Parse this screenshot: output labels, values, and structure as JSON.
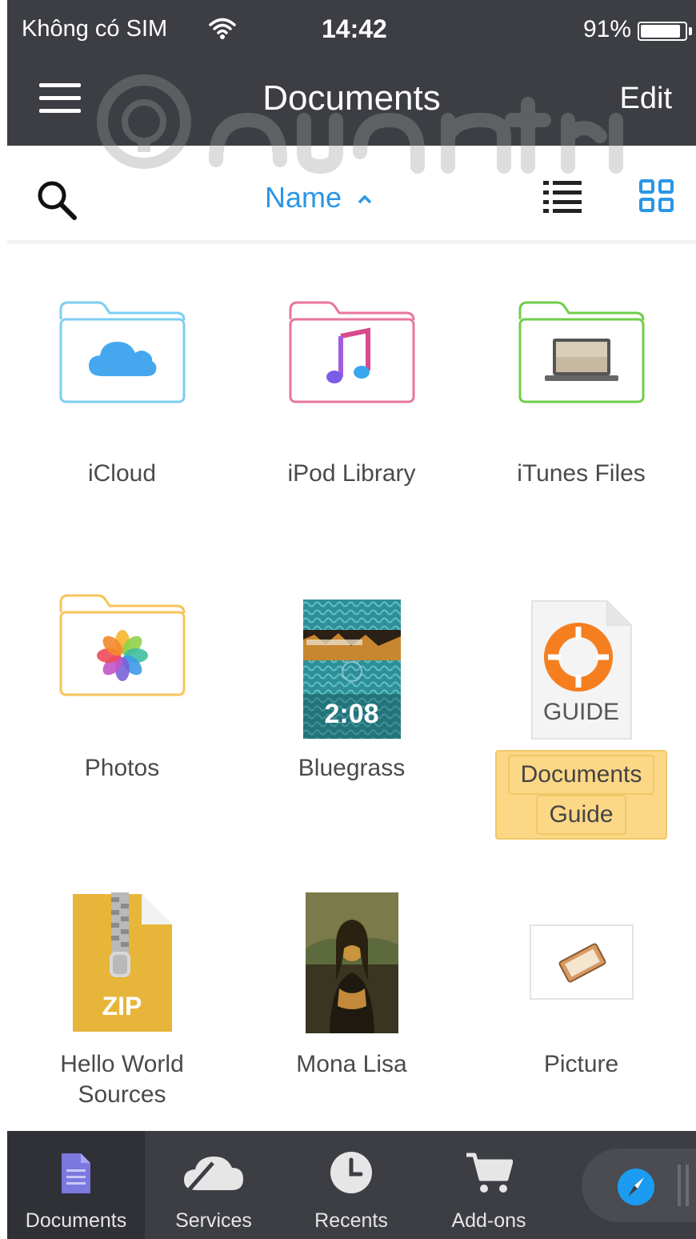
{
  "status_bar": {
    "carrier": "Không có SIM",
    "time": "14:42",
    "battery": "91%",
    "battery_level": 0.91
  },
  "nav": {
    "title": "Documents",
    "edit_label": "Edit"
  },
  "toolbar": {
    "sort_label": "Name"
  },
  "colors": {
    "bar": "#3c3e44",
    "accent": "#2a96e6",
    "selected": "#fbd786"
  },
  "items": [
    {
      "label": "iCloud",
      "icon": "icloud-folder-icon"
    },
    {
      "label": "iPod Library",
      "icon": "music-folder-icon"
    },
    {
      "label": "iTunes Files",
      "icon": "itunes-files-folder-icon"
    },
    {
      "label": "Photos",
      "icon": "photos-folder-icon"
    },
    {
      "label": "Bluegrass",
      "icon": "video-thumbnail",
      "duration": "2:08"
    },
    {
      "label": "Documents Guide",
      "label_line1": "Documents",
      "label_line2": "Guide",
      "icon": "guide-document-icon",
      "badge": "GUIDE",
      "selected": true
    },
    {
      "label": "Hello World Sources",
      "label_line1": "Hello World",
      "label_line2": "Sources",
      "icon": "zip-archive-icon",
      "badge": "ZIP"
    },
    {
      "label": "Mona Lisa",
      "icon": "image-thumbnail"
    },
    {
      "label": "Picture",
      "icon": "picture-file-icon"
    }
  ],
  "tabs": [
    {
      "label": "Documents",
      "icon": "document-icon",
      "active": true
    },
    {
      "label": "Services",
      "icon": "cloud-icon"
    },
    {
      "label": "Recents",
      "icon": "clock-icon"
    },
    {
      "label": "Add-ons",
      "icon": "cart-icon"
    }
  ]
}
